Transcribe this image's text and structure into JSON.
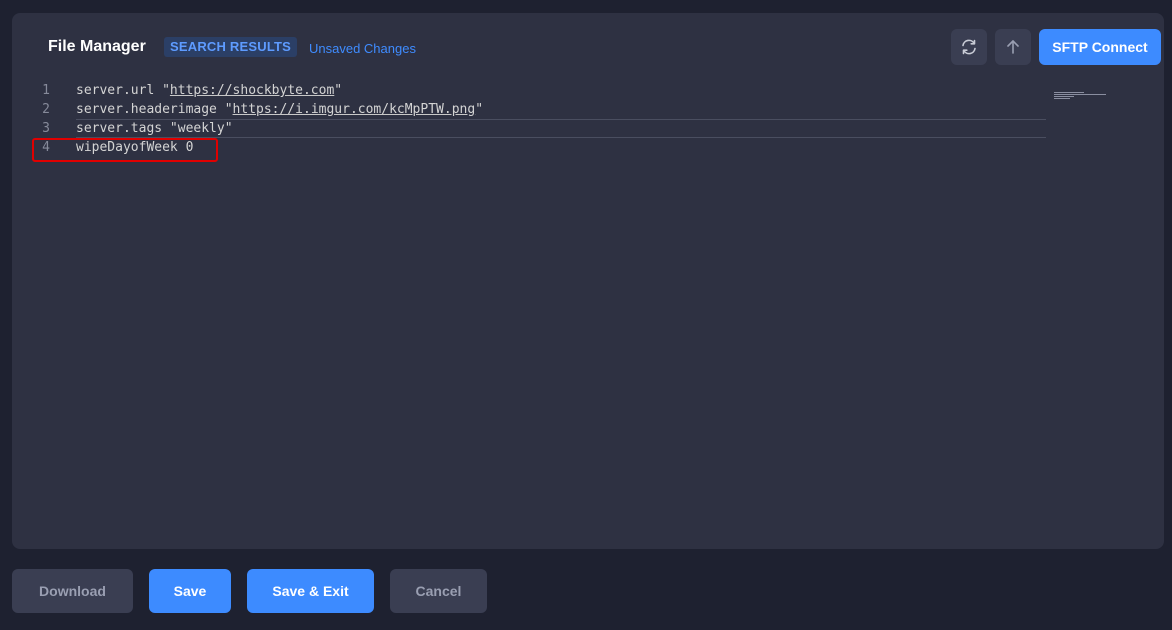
{
  "header": {
    "title": "File Manager",
    "badge": "SEARCH RESULTS",
    "status": "Unsaved Changes",
    "refresh_icon": "refresh-icon",
    "upload_icon": "arrow-up-icon",
    "sftp_label": "SFTP Connect"
  },
  "editor": {
    "lines": [
      {
        "number": "1",
        "prefix": "server.url \"",
        "link": "https://shockbyte.com",
        "suffix": "\""
      },
      {
        "number": "2",
        "prefix": "server.headerimage \"",
        "link": "https://i.imgur.com/kcMpPTW.png",
        "suffix": "\""
      },
      {
        "number": "3",
        "text": "server.tags \"weekly\""
      },
      {
        "number": "4",
        "text": "wipeDayofWeek 0"
      }
    ],
    "highlighted_line": "4"
  },
  "footer": {
    "download_label": "Download",
    "save_label": "Save",
    "save_exit_label": "Save & Exit",
    "cancel_label": "Cancel"
  },
  "colors": {
    "accent": "#3d8bff",
    "highlight_border": "#e00000",
    "panel_bg": "#2e3142",
    "page_bg": "#1e2130"
  }
}
